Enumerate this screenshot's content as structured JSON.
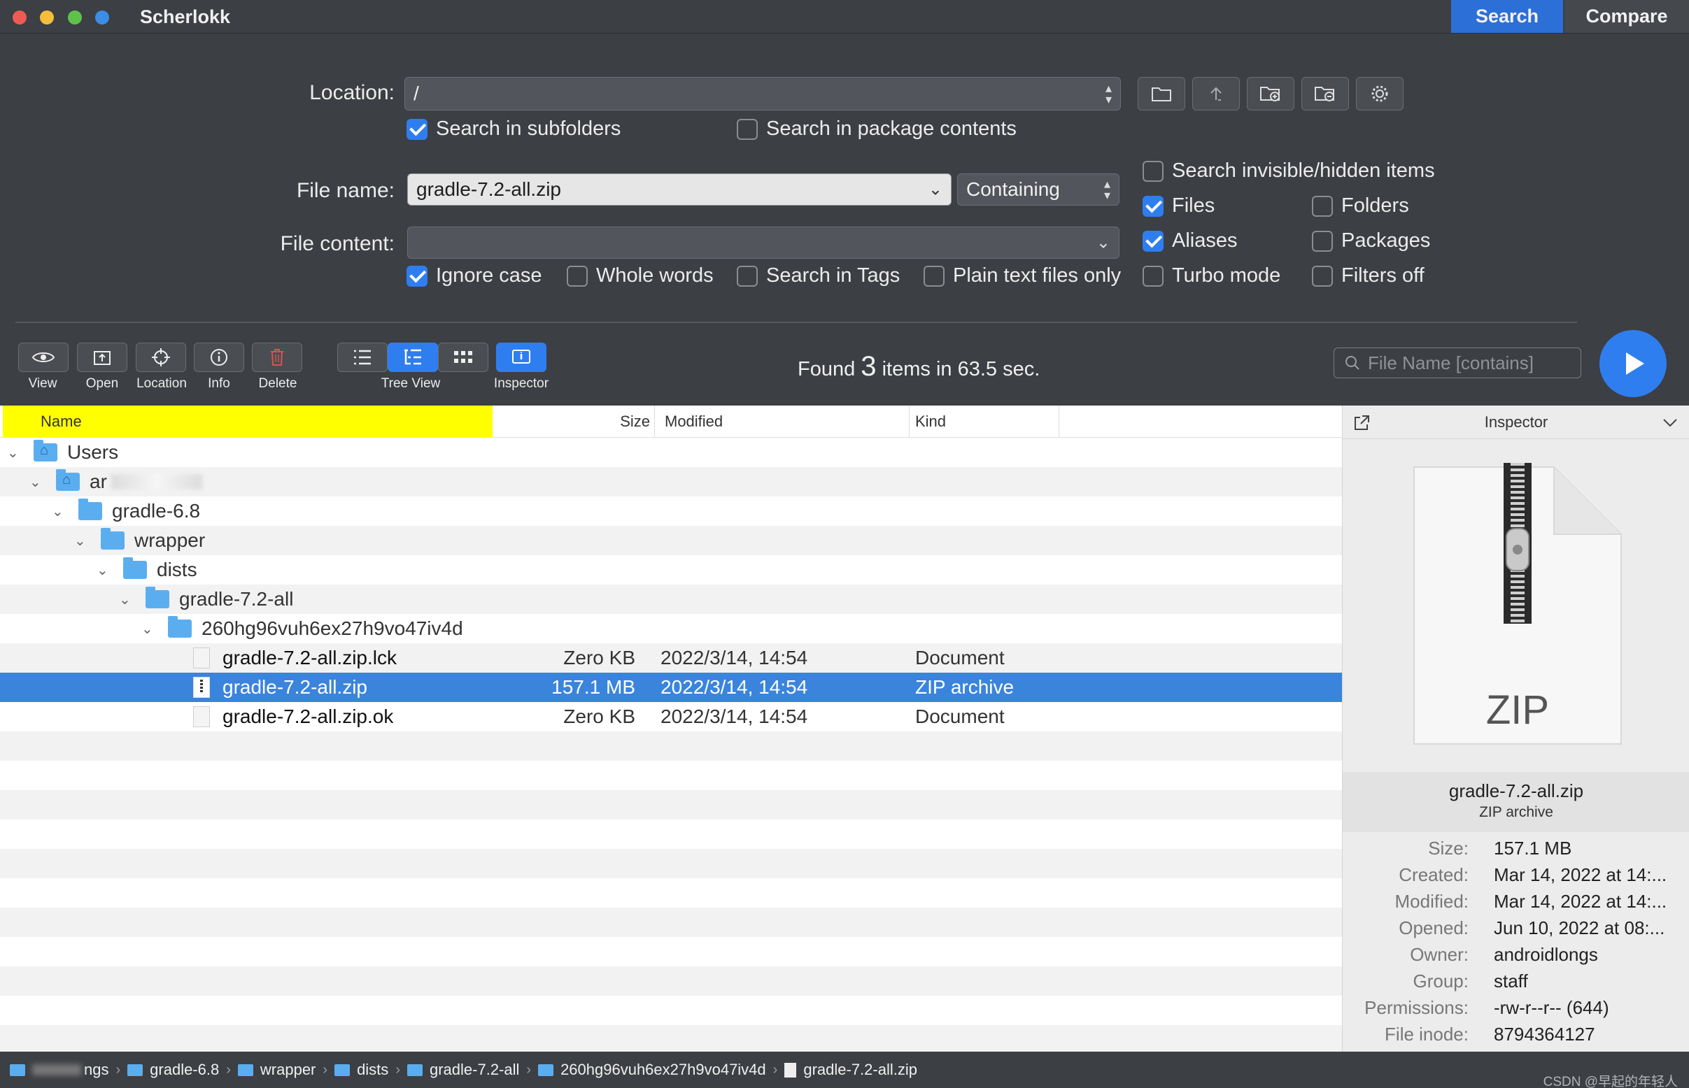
{
  "window": {
    "title": "Scherlokk",
    "modes": [
      "Search",
      "Compare"
    ],
    "active_mode": "Search"
  },
  "search": {
    "location_label": "Location:",
    "location_value": "/",
    "subfolders_label": "Search in subfolders",
    "subfolders_checked": true,
    "package_label": "Search in package contents",
    "package_checked": false,
    "filename_label": "File name:",
    "filename_value": "gradle-7.2-all.zip",
    "match_mode": "Containing",
    "content_label": "File content:",
    "content_value": "",
    "options": {
      "ignore_case": {
        "label": "Ignore case",
        "checked": true
      },
      "whole_words": {
        "label": "Whole words",
        "checked": false
      },
      "search_tags": {
        "label": "Search in Tags",
        "checked": false
      },
      "plain_text": {
        "label": "Plain text files only",
        "checked": false
      },
      "invisible": {
        "label": "Search invisible/hidden items",
        "checked": false
      },
      "files": {
        "label": "Files",
        "checked": true
      },
      "folders": {
        "label": "Folders",
        "checked": false
      },
      "aliases": {
        "label": "Aliases",
        "checked": true
      },
      "packages": {
        "label": "Packages",
        "checked": false
      },
      "turbo": {
        "label": "Turbo mode",
        "checked": false
      },
      "filters_off": {
        "label": "Filters off",
        "checked": false
      }
    }
  },
  "toolbar": {
    "view": "View",
    "open": "Open",
    "location": "Location",
    "info": "Info",
    "delete": "Delete",
    "tree_view": "Tree View",
    "inspector": "Inspector",
    "status_prefix": "Found",
    "status_count": "3",
    "status_suffix": "items in 63.5 sec.",
    "quick_filter_placeholder": "File Name [contains]"
  },
  "results": {
    "columns": {
      "name": "Name",
      "size": "Size",
      "modified": "Modified",
      "kind": "Kind"
    },
    "rows": [
      {
        "name": "Users",
        "size": "",
        "modified": "",
        "kind": ""
      },
      {
        "name": "ar",
        "size": "",
        "modified": "",
        "kind": ""
      },
      {
        "name": "gradle-6.8",
        "size": "",
        "modified": "",
        "kind": ""
      },
      {
        "name": "wrapper",
        "size": "",
        "modified": "",
        "kind": ""
      },
      {
        "name": "dists",
        "size": "",
        "modified": "",
        "kind": ""
      },
      {
        "name": "gradle-7.2-all",
        "size": "",
        "modified": "",
        "kind": ""
      },
      {
        "name": "260hg96vuh6ex27h9vo47iv4d",
        "size": "",
        "modified": "",
        "kind": ""
      },
      {
        "name": "gradle-7.2-all.zip.lck",
        "size": "Zero KB",
        "modified": "2022/3/14, 14:54",
        "kind": "Document"
      },
      {
        "name": "gradle-7.2-all.zip",
        "size": "157.1 MB",
        "modified": "2022/3/14, 14:54",
        "kind": "ZIP archive"
      },
      {
        "name": "gradle-7.2-all.zip.ok",
        "size": "Zero KB",
        "modified": "2022/3/14, 14:54",
        "kind": "Document"
      }
    ]
  },
  "inspector": {
    "title": "Inspector",
    "preview_label": "ZIP",
    "file_name": "gradle-7.2-all.zip",
    "file_kind": "ZIP archive",
    "properties": [
      {
        "key": "Size:",
        "value": "157.1 MB"
      },
      {
        "key": "Created:",
        "value": "Mar 14, 2022 at 14:..."
      },
      {
        "key": "Modified:",
        "value": "Mar 14, 2022 at 14:..."
      },
      {
        "key": "Opened:",
        "value": "Jun 10, 2022 at 08:..."
      },
      {
        "key": "Owner:",
        "value": "androidlongs"
      },
      {
        "key": "Group:",
        "value": "staff"
      },
      {
        "key": "Permissions:",
        "value": "-rw-r--r-- (644)"
      },
      {
        "key": "File inode:",
        "value": "8794364127"
      }
    ]
  },
  "pathbar": {
    "crumbs": [
      "ngs",
      "gradle-6.8",
      "wrapper",
      "dists",
      "gradle-7.2-all",
      "260hg96vuh6ex27h9vo47iv4d",
      "gradle-7.2-all.zip"
    ]
  },
  "watermark": "CSDN @早起的年轻人",
  "colors": {
    "accent": "#2f7ef0",
    "selection": "#3a84dc",
    "name_header": "#ffff00",
    "chrome": "#3c3f44"
  }
}
